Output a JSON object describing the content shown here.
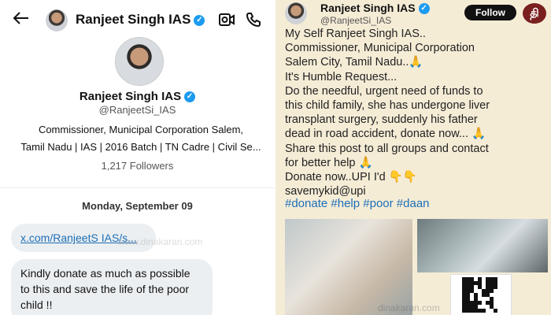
{
  "dm": {
    "header_name": "Ranjeet Singh IAS",
    "profile_name": "Ranjeet Singh IAS",
    "handle": "@RanjeetSi_IAS",
    "bio_line1": "Commissioner, Municipal Corporation Salem,",
    "bio_line2": "Tamil Nadu | IAS | 2016 Batch | TN Cadre | Civil Se...",
    "followers": "1,217 Followers",
    "date": "Monday, September 09",
    "link_text": "x.com/RanjeetS IAS/s...",
    "message_line1": "Kindly donate as much as possible",
    "message_line2": "to this and save the life of the poor",
    "message_line3": "child  !!",
    "watermark": "www.dinakaran.com"
  },
  "tweet": {
    "name": "Ranjeet Singh IAS",
    "handle": "@RanjeetSi_IAS",
    "follow_label": "Follow",
    "logo_text": "தி",
    "lines": [
      "My Self Ranjeet Singh IAS..",
      "Commissioner, Municipal Corporation",
      "Salem City, Tamil Nadu..🙏",
      "It's Humble Request...",
      "Do the needful, urgent need of funds to",
      "this child family, she has undergone liver",
      "transplant surgery, suddenly his father",
      "dead in road accident, donate now... 🙏",
      "Share this post to all groups and contact",
      "for better help 🙏",
      "Donate now..UPI I'd 👇👇",
      "savemykid@upi"
    ],
    "hashtags": "#donate #help #poor #daan",
    "watermark": "dinakaran.com"
  },
  "colors": {
    "verified": "#1d9bf0",
    "link": "#1d6fb8",
    "tweet_bg": "#f5ecd6"
  },
  "icons": [
    "back-arrow-icon",
    "verified-icon",
    "video-call-icon",
    "phone-icon",
    "news-logo"
  ]
}
